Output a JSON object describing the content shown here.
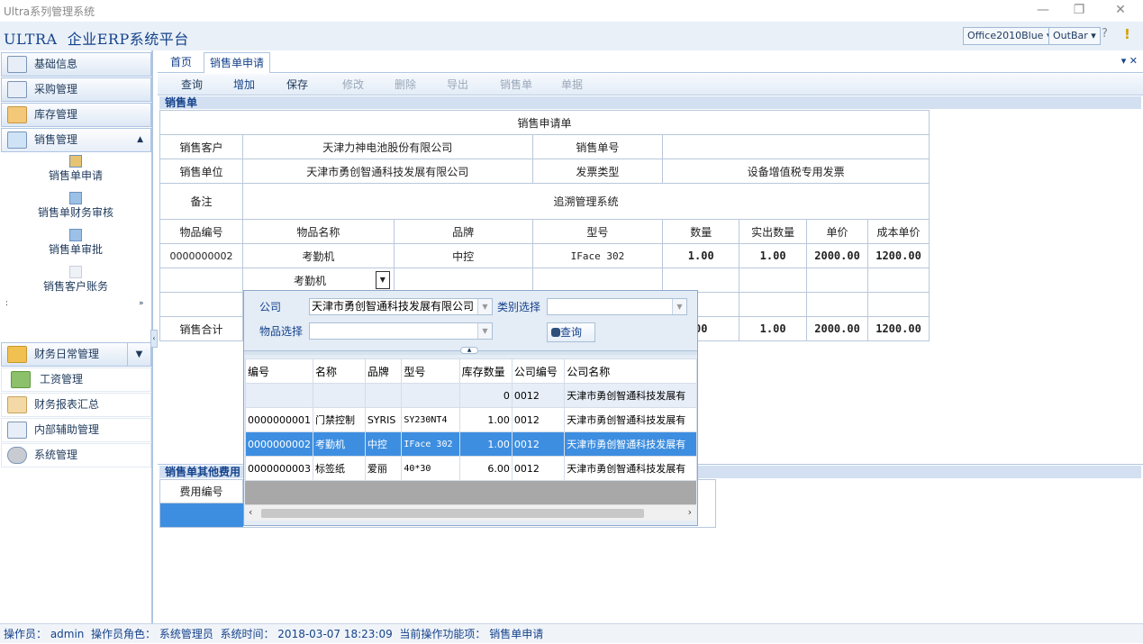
{
  "window": {
    "title": "Ultra系列管理系统",
    "minimize": "—",
    "restore": "❐",
    "close": "✕"
  },
  "header": {
    "app_title": "ULTRA  企业ERP系统平台",
    "theme": "Office2010Blue ▾",
    "bar_style": "OutBar ▾",
    "help": "?",
    "alert": "!"
  },
  "sidebar": {
    "top_items": [
      {
        "label": "基础信息"
      },
      {
        "label": "采购管理"
      },
      {
        "label": "库存管理"
      },
      {
        "label": "销售管理"
      }
    ],
    "sub_items": [
      {
        "label": "销售单申请"
      },
      {
        "label": "销售单财务审核"
      },
      {
        "label": "销售单审批"
      },
      {
        "label": "销售客户账务"
      }
    ],
    "bottom_items": [
      {
        "label": "财务日常管理"
      },
      {
        "label": "工资管理"
      },
      {
        "label": "财务报表汇总"
      },
      {
        "label": "内部辅助管理"
      },
      {
        "label": "系统管理"
      }
    ]
  },
  "tabs": [
    {
      "label": "首页"
    },
    {
      "label": "销售单申请"
    }
  ],
  "tab_controls": "▾ ✕",
  "toolbar": {
    "query": "查询",
    "add": "增加",
    "save": "保存",
    "edit": "修改",
    "delete": "删除",
    "export": "导出",
    "sale": "销售单",
    "doc": "单据"
  },
  "section_title": "销售单",
  "form": {
    "title": "销售申请单",
    "customer_label": "销售客户",
    "customer": "天津力神电池股份有限公司",
    "order_no_label": "销售单号",
    "order_no": "",
    "unit_label": "销售单位",
    "unit": "天津市勇创智通科技发展有限公司",
    "invoice_label": "发票类型",
    "invoice": "设备增值税专用发票",
    "remark_label": "备注",
    "remark": "追溯管理系统",
    "columns": [
      "物品编号",
      "物品名称",
      "品牌",
      "型号",
      "数量",
      "实出数量",
      "单价",
      "成本单价"
    ],
    "row1": [
      "0000000002",
      "考勤机",
      "中控",
      "IFace 302",
      "1.00",
      "1.00",
      "2000.00",
      "1200.00"
    ],
    "edit_value": "考勤机",
    "total_label": "销售合计",
    "totals": [
      "00",
      "1.00",
      "2000.00",
      "1200.00"
    ]
  },
  "popup": {
    "company_label": "公司",
    "company": "天津市勇创智通科技发展有限公司",
    "category_label": "类别选择",
    "category": "",
    "item_label": "物品选择",
    "item": "",
    "query": "查询",
    "columns": [
      "编号",
      "名称",
      "品牌",
      "型号",
      "库存数量",
      "公司编号",
      "公司名称"
    ],
    "rows": [
      [
        "",
        "",
        "",
        "",
        "0",
        "0012",
        "天津市勇创智通科技发展有"
      ],
      [
        "0000000001",
        "门禁控制",
        "SYRIS",
        "SY230NT4",
        "1.00",
        "0012",
        "天津市勇创智通科技发展有"
      ],
      [
        "0000000002",
        "考勤机",
        "中控",
        "IFace 302",
        "1.00",
        "0012",
        "天津市勇创智通科技发展有"
      ],
      [
        "0000000003",
        "标签纸",
        "爱丽",
        "40*30",
        "6.00",
        "0012",
        "天津市勇创智通科技发展有"
      ]
    ]
  },
  "other_fees": {
    "title": "销售单其他费用",
    "col1": "费用编号"
  },
  "status": {
    "text": "操作员： admin  操作员角色： 系统管理员  系统时间： 2018-03-07 18:23:09  当前操作功能项： 销售单申请"
  }
}
